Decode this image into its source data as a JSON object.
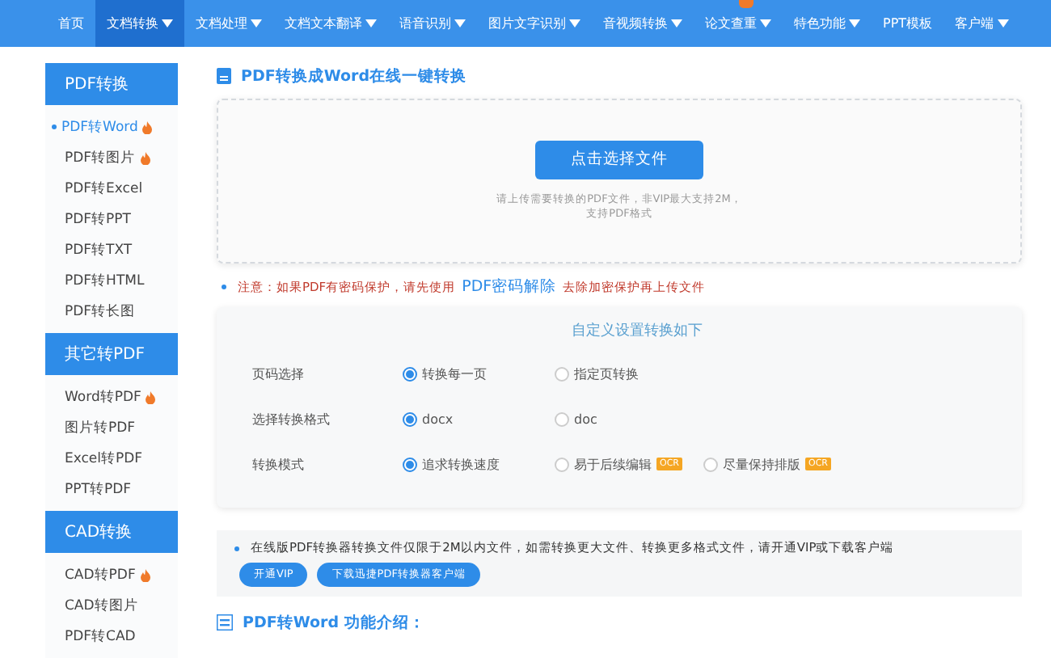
{
  "nav": [
    {
      "label": "首页",
      "dropdown": false,
      "selected": false,
      "badge": false
    },
    {
      "label": "文档转换",
      "dropdown": true,
      "selected": true,
      "badge": false
    },
    {
      "label": "文档处理",
      "dropdown": true,
      "selected": false,
      "badge": false
    },
    {
      "label": "文档文本翻译",
      "dropdown": true,
      "selected": false,
      "badge": false
    },
    {
      "label": "语音识别",
      "dropdown": true,
      "selected": false,
      "badge": false
    },
    {
      "label": "图片文字识别",
      "dropdown": true,
      "selected": false,
      "badge": false
    },
    {
      "label": "音视频转换",
      "dropdown": true,
      "selected": false,
      "badge": false
    },
    {
      "label": "论文查重",
      "dropdown": true,
      "selected": false,
      "badge": true
    },
    {
      "label": "特色功能",
      "dropdown": true,
      "selected": false,
      "badge": false
    },
    {
      "label": "PPT模板",
      "dropdown": false,
      "selected": false,
      "badge": false
    },
    {
      "label": "客户端",
      "dropdown": true,
      "selected": false,
      "badge": false
    }
  ],
  "sidebar": [
    {
      "title": "PDF转换",
      "items": [
        {
          "label": "PDF转Word",
          "hot": true,
          "selected": true
        },
        {
          "label": "PDF转图片",
          "hot": true,
          "selected": false
        },
        {
          "label": "PDF转Excel",
          "hot": false,
          "selected": false
        },
        {
          "label": "PDF转PPT",
          "hot": false,
          "selected": false
        },
        {
          "label": "PDF转TXT",
          "hot": false,
          "selected": false
        },
        {
          "label": "PDF转HTML",
          "hot": false,
          "selected": false
        },
        {
          "label": "PDF转长图",
          "hot": false,
          "selected": false
        }
      ]
    },
    {
      "title": "其它转PDF",
      "items": [
        {
          "label": "Word转PDF",
          "hot": true,
          "selected": false
        },
        {
          "label": "图片转PDF",
          "hot": false,
          "selected": false
        },
        {
          "label": "Excel转PDF",
          "hot": false,
          "selected": false
        },
        {
          "label": "PPT转PDF",
          "hot": false,
          "selected": false
        }
      ]
    },
    {
      "title": "CAD转换",
      "items": [
        {
          "label": "CAD转PDF",
          "hot": true,
          "selected": false
        },
        {
          "label": "CAD转图片",
          "hot": false,
          "selected": false
        },
        {
          "label": "PDF转CAD",
          "hot": false,
          "selected": false
        }
      ]
    }
  ],
  "page_title": "PDF转换成Word在线一键转换",
  "upload": {
    "button": "点击选择文件",
    "hint_lines": [
      "请上传需要转换的PDF文件，非VIP最大支持2M，",
      "支持PDF格式"
    ]
  },
  "notice": {
    "before": "注意：如果PDF有密码保护，请先使用",
    "link": "PDF密码解除",
    "after": "去除加密保护再上传文件"
  },
  "settings": {
    "title": "自定义设置转换如下",
    "rows": [
      {
        "label": "页码选择",
        "options": [
          {
            "label": "转换每一页",
            "selected": true
          },
          {
            "label": "指定页转换",
            "selected": false
          }
        ]
      },
      {
        "label": "选择转换格式",
        "options": [
          {
            "label": "docx",
            "selected": true
          },
          {
            "label": "doc",
            "selected": false
          }
        ]
      },
      {
        "label": "转换模式",
        "options": [
          {
            "label": "追求转换速度",
            "selected": true
          },
          {
            "label": "易于后续编辑",
            "selected": false,
            "tag": "OCR"
          },
          {
            "label": "尽量保持排版",
            "selected": false,
            "tag": "OCR"
          }
        ]
      }
    ]
  },
  "vip_notice": {
    "text": "在线版PDF转换器转换文件仅限于2M以内文件，如需转换更大文件、转换更多格式文件，请开通VIP或下载客户端",
    "buttons": [
      "开通VIP",
      "下载迅捷PDF转换器客户端"
    ]
  },
  "intro_title": "PDF转Word 功能介绍："
}
